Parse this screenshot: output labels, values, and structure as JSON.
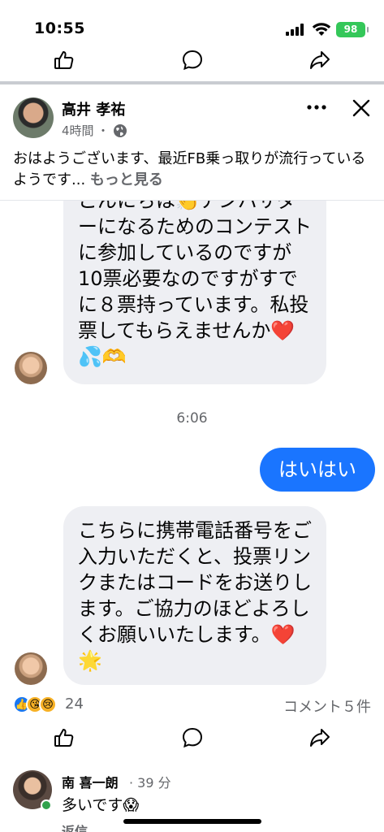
{
  "status_bar": {
    "time": "10:55",
    "battery": "98"
  },
  "post": {
    "author": "高井 孝祐",
    "time": "4時間",
    "dot": "・",
    "text": "おはようございます、最近FB乗っ取りが流行っているようです...",
    "see_more": "もっと見る"
  },
  "screenshot": {
    "first_message": "こんにちは👏アンバサダーになるためのコンテストに参加しているのですが10票必要なのですがすでに８票持っています。私投票してもらえませんか❤️ 💦🫶",
    "timestamp": "6:06",
    "sent_message": "はいはい",
    "second_message": "こちらに携帯電話番号をご入力いただくと、投票リンクまたはコードをお送りします。ご協力のほどよろしくお願いいたします。❤️ 🌟"
  },
  "reactions": {
    "icons": [
      "👍",
      "😘",
      "😢"
    ],
    "count": "24",
    "comments": "コメント５件"
  },
  "comment": {
    "name": "南 喜一朗",
    "time": "· 39 分",
    "text": "多いです😱",
    "reply": "返信"
  },
  "icons": {
    "like": "thumbs-up-icon",
    "comment": "comment-bubble-icon",
    "share": "share-arrow-icon",
    "more": "more-dots-icon",
    "close": "close-icon",
    "globe": "globe-icon"
  },
  "colors": {
    "accent": "#1a75ff",
    "muted": "#65676b",
    "bubble": "#eeeff3",
    "online": "#31a24c"
  }
}
